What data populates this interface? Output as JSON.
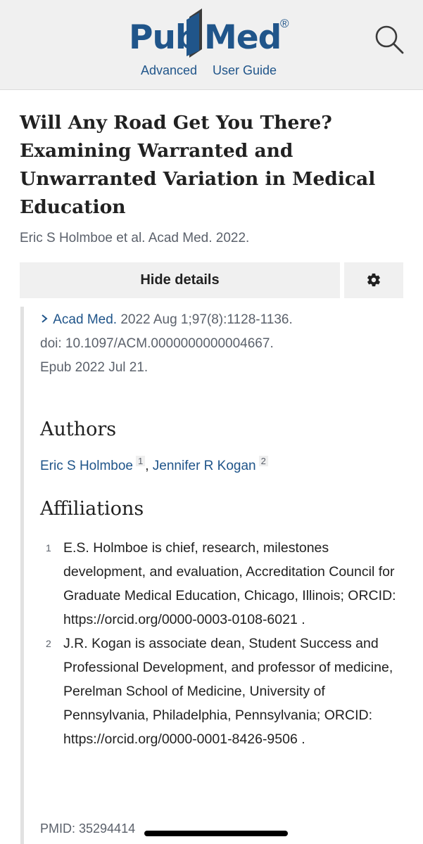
{
  "header": {
    "logo_pub": "Pub",
    "logo_med": "Med",
    "logo_reg": "®",
    "advanced_label": "Advanced",
    "user_guide_label": "User Guide",
    "brand_color": "#20558a"
  },
  "article": {
    "title": "Will Any Road Get You There? Examining Warranted and Unwarranted Variation in Medical Education",
    "citation": "Eric S Holmboe et al. Acad Med. 2022."
  },
  "details": {
    "hide_details_label": "Hide details",
    "journal_link": "Acad Med.",
    "journal_rest": " 2022 Aug 1;97(8):1128-1136.",
    "doi": "doi: 10.1097/ACM.0000000000004667.",
    "epub": "Epub 2022 Jul 21."
  },
  "authors": {
    "heading": "Authors",
    "list": [
      {
        "name": "Eric S Holmboe",
        "sup": "1"
      },
      {
        "name": "Jennifer R Kogan",
        "sup": "2"
      }
    ],
    "separator": ", "
  },
  "affiliations": {
    "heading": "Affiliations",
    "items": [
      {
        "num": "1",
        "text": "E.S. Holmboe is chief, research, milestones development, and evaluation, Accreditation Council for Graduate Medical Education, Chicago, Illinois; ORCID: https://orcid.org/0000-0003-0108-6021 ."
      },
      {
        "num": "2",
        "text": "J.R. Kogan is associate dean, Student Success and Professional Development, and professor of medicine, Perelman School of Medicine, University of Pennsylvania, Philadelphia, Pennsylvania; ORCID: https://orcid.org/0000-0001-8426-9506 ."
      }
    ]
  },
  "pmid": "PMID: 35294414",
  "icons": {
    "search": "search-icon",
    "settings": "gear-icon",
    "chevron": "chevron-right-icon"
  }
}
